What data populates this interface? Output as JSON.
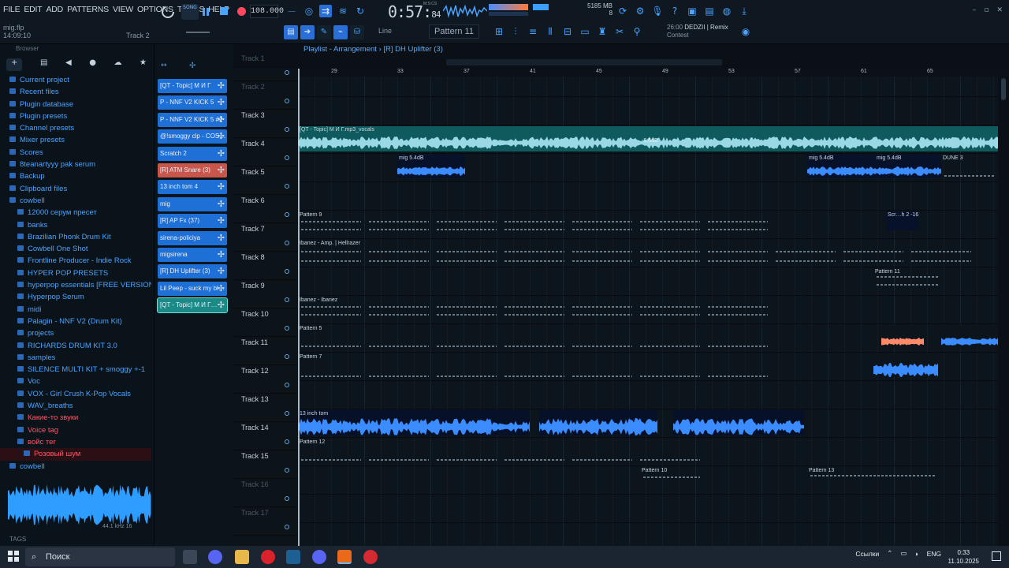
{
  "menu": [
    "FILE",
    "EDIT",
    "ADD",
    "PATTERNS",
    "VIEW",
    "OPTIONS",
    "TOOLS",
    "HELP"
  ],
  "project": {
    "file": "mig.flp",
    "time": "14:09:10",
    "focus": "Track 2"
  },
  "transport": {
    "mode": "SONG",
    "tempo": "108.000",
    "time_main": "0:57:",
    "time_sub": "84",
    "time_sig": "M:S:CS"
  },
  "memory": {
    "mb": "5185 MB",
    "value": "35",
    "count": "8"
  },
  "toolbar2": {
    "snap": "Line",
    "pattern": "Pattern 11",
    "hint_time": "26:00",
    "hint_line1": "DEDZII | Remix",
    "hint_line2": "Contest"
  },
  "browser": {
    "header": "Browser",
    "tabs": [
      "+",
      "▤",
      "◀",
      "●",
      "☁",
      "★"
    ],
    "items": [
      {
        "label": "Current project",
        "type": "blue"
      },
      {
        "label": "Recent files",
        "type": "blue"
      },
      {
        "label": "Plugin database",
        "type": "blue"
      },
      {
        "label": "Plugin presets",
        "type": "blue"
      },
      {
        "label": "Channel presets",
        "type": "blue"
      },
      {
        "label": "Mixer presets",
        "type": "blue"
      },
      {
        "label": "Scores",
        "type": "blue"
      },
      {
        "label": "8teanartyyy pak serum",
        "type": "blue"
      },
      {
        "label": "Backup",
        "type": "blue"
      },
      {
        "label": "Clipboard files",
        "type": "blue"
      },
      {
        "label": "cowbell",
        "type": "blue"
      },
      {
        "label": "12000 серум пресет",
        "type": "blue"
      },
      {
        "label": "banks",
        "type": "blue"
      },
      {
        "label": "Brazilian Phonk Drum Kit",
        "type": "blue"
      },
      {
        "label": "Cowbell One Shot",
        "type": "blue"
      },
      {
        "label": "Frontline Producer - Indie Rock",
        "type": "blue"
      },
      {
        "label": "HYPER POP PRESETS",
        "type": "blue"
      },
      {
        "label": "hyperpop essentials  [FREE VERSION]",
        "type": "blue"
      },
      {
        "label": "Hyperpop Serum",
        "type": "blue"
      },
      {
        "label": "midi",
        "type": "blue"
      },
      {
        "label": "Palagin - NNF V2 (Drum Kit)",
        "type": "blue"
      },
      {
        "label": "projects",
        "type": "blue"
      },
      {
        "label": "RICHARDS DRUM KIT 3.0",
        "type": "blue"
      },
      {
        "label": "samples",
        "type": "blue"
      },
      {
        "label": "SILENCE MULTI KIT + smoggy +-1",
        "type": "blue"
      },
      {
        "label": "Voc",
        "type": "blue"
      },
      {
        "label": "VOX - Girl Crush K-Pop Vocals",
        "type": "blue"
      },
      {
        "label": "WAV_breaths",
        "type": "blue"
      },
      {
        "label": "Какие-то звуки",
        "type": "red"
      },
      {
        "label": "Voice tag",
        "type": "red"
      },
      {
        "label": "войс тег",
        "type": "red"
      },
      {
        "label": "Розовый шум",
        "type": "sel"
      },
      {
        "label": "cowbell",
        "type": "blue"
      }
    ],
    "rate": "44.1 kHz 16",
    "tags": "TAGS"
  },
  "picker": [
    {
      "label": "[QT - Topic] М И Г",
      "color": "#1e6fd6"
    },
    {
      "label": "P - NNF V2 KICK 5",
      "color": "#1e6fd6"
    },
    {
      "label": "P - NNF V2 KICK 5 #2",
      "color": "#1e6fd6"
    },
    {
      "label": "@!smoggy clp - COS…",
      "color": "#1e6fd6"
    },
    {
      "label": "Scratch 2",
      "color": "#1e6fd6"
    },
    {
      "label": "[R] ATM Snare (3)",
      "color": "#c8564a"
    },
    {
      "label": "13 inch tom 4",
      "color": "#1e6fd6"
    },
    {
      "label": "mig",
      "color": "#1e6fd6"
    },
    {
      "label": "[R] AP Fx (37)",
      "color": "#1e6fd6"
    },
    {
      "label": "sirena-policiya",
      "color": "#1e6fd6"
    },
    {
      "label": "migsirena",
      "color": "#1e6fd6"
    },
    {
      "label": "[R] DH Uplifter (3)",
      "color": "#1e6fd6"
    },
    {
      "label": "Lil Peep - suck my bl…",
      "color": "#1e6fd6"
    },
    {
      "label": "[QT - Topic] М И Г…",
      "color": "#1b8a86"
    }
  ],
  "playlist": {
    "title": "Playlist - Arrangement",
    "path": "[R] DH Uplifter (3)",
    "ruler": [
      "29",
      "33",
      "37",
      "41",
      "45",
      "49",
      "53",
      "57",
      "61",
      "65"
    ]
  },
  "tracks": [
    "Track 1",
    "Track 2",
    "Track 3",
    "Track 4",
    "Track 5",
    "Track 6",
    "Track 7",
    "Track 8",
    "Track 9",
    "Track 10",
    "Track 11",
    "Track 12",
    "Track 13",
    "Track 14",
    "Track 15",
    "Track 16",
    "Track 17"
  ],
  "clips": [
    {
      "track": 2,
      "label": "[QT - Topic] М И Г.mp3_vocals",
      "color": "#1b8a86",
      "kind": "audio"
    },
    {
      "track": 3,
      "label": "mig 5.4dB",
      "color": "#1537a8",
      "kind": "audio"
    },
    {
      "track": 3,
      "label": "mig 5.4dB",
      "color": "#1537a8",
      "kind": "audio"
    },
    {
      "track": 3,
      "label": "mig 5.4dB",
      "color": "#1537a8",
      "kind": "audio"
    },
    {
      "track": 3,
      "label": "DUNE 3",
      "color": "#0e1720",
      "kind": "pat"
    },
    {
      "track": 5,
      "label": "Pattern 9",
      "kind": "pat"
    },
    {
      "track": 5,
      "label": "Scr…h 2 -16.2dB",
      "color": "#1537a8",
      "kind": "audio"
    },
    {
      "track": 6,
      "label": "Ibanez - Amp. | Hellrazer",
      "kind": "pat"
    },
    {
      "track": 7,
      "label": "Pattern 11",
      "kind": "pat"
    },
    {
      "track": 8,
      "label": "Ibanez - Ibanez",
      "kind": "pat"
    },
    {
      "track": 9,
      "label": "Pattern 5",
      "kind": "pat"
    },
    {
      "track": 10,
      "label": "Pattern 7",
      "kind": "pat"
    },
    {
      "track": 12,
      "label": "13 inch tom",
      "color": "#0f3c86",
      "kind": "audio"
    },
    {
      "track": 13,
      "label": "Pattern 12",
      "kind": "pat"
    },
    {
      "track": 14,
      "label": "Pattern 10",
      "kind": "pat"
    },
    {
      "track": 14,
      "label": "Pattern 13",
      "kind": "pat"
    }
  ],
  "waveform_db": "-8.5dB",
  "taskbar": {
    "search": "Поиск",
    "links": "Ссылки",
    "lang": "ENG",
    "time": "0:33",
    "date": "11.10.2025"
  },
  "colors": {
    "accent": "#4aa3ff",
    "record": "#ff4860",
    "red_item": "#ff5566",
    "teal_clip": "#1b8a86",
    "blue_clip": "#1537a8"
  }
}
